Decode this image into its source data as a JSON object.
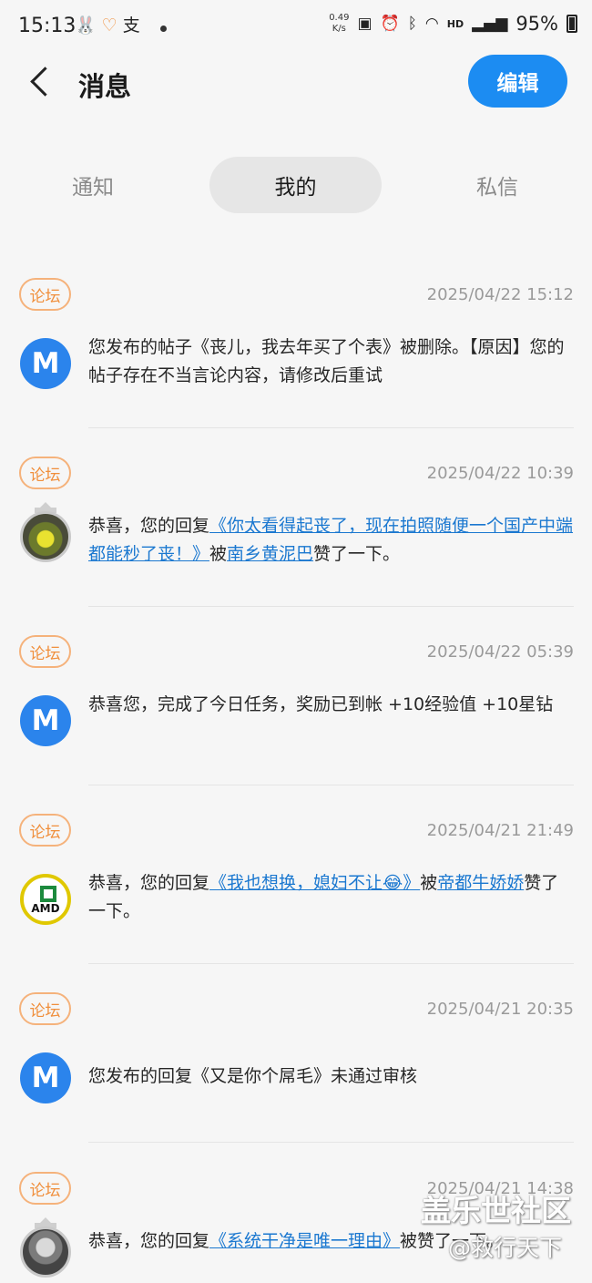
{
  "status_bar": {
    "time": "15:13",
    "notif_icons": [
      "bunny-icon",
      "heart-icon",
      "alipay-icon"
    ],
    "notif_alipay": "支",
    "speed_value": "0.49",
    "speed_unit": "K/s",
    "hd": "HD",
    "battery": "95%"
  },
  "header": {
    "title": "消息",
    "edit_label": "编辑"
  },
  "tabs": [
    {
      "label": "通知"
    },
    {
      "label": "我的"
    },
    {
      "label": "私信"
    }
  ],
  "messages": [
    {
      "tag": "论坛",
      "time": "2025/04/22 15:12",
      "avatar": "M",
      "text": "您发布的帖子《丧儿，我去年买了个表》被删除。【原因】您的帖子存在不当言论内容，请修改后重试"
    },
    {
      "tag": "论坛",
      "time": "2025/04/22 10:39",
      "prefix": "恭喜，您的回复",
      "link_post": "《你太看得起丧了，现在拍照随便一个国产中端都能秒了丧！》",
      "middle": "被",
      "link_user": "南乡黄泥巴",
      "suffix": "赞了一下。"
    },
    {
      "tag": "论坛",
      "time": "2025/04/22 05:39",
      "avatar": "M",
      "text": "恭喜您，完成了今日任务，奖励已到帐 +10经验值 +10星钻"
    },
    {
      "tag": "论坛",
      "time": "2025/04/21 21:49",
      "prefix": "恭喜，您的回复",
      "link_post": "《我也想换，媳妇不让😂》",
      "middle": "被",
      "link_user": "帝都牛娇娇",
      "suffix": "赞了一下。",
      "avatar_text": "AMD"
    },
    {
      "tag": "论坛",
      "time": "2025/04/21 20:35",
      "avatar": "M",
      "text": "您发布的回复《又是你个屌毛》未通过审核"
    },
    {
      "tag": "论坛",
      "time": "2025/04/21 14:38",
      "prefix": "恭喜，您的回复",
      "link_post": "《系统干净是唯一理由》",
      "middle": "被",
      "link_user": "",
      "suffix": "赞了一下。"
    }
  ],
  "watermark": {
    "line1": "盖乐世社区",
    "line2": "@救行天下"
  }
}
